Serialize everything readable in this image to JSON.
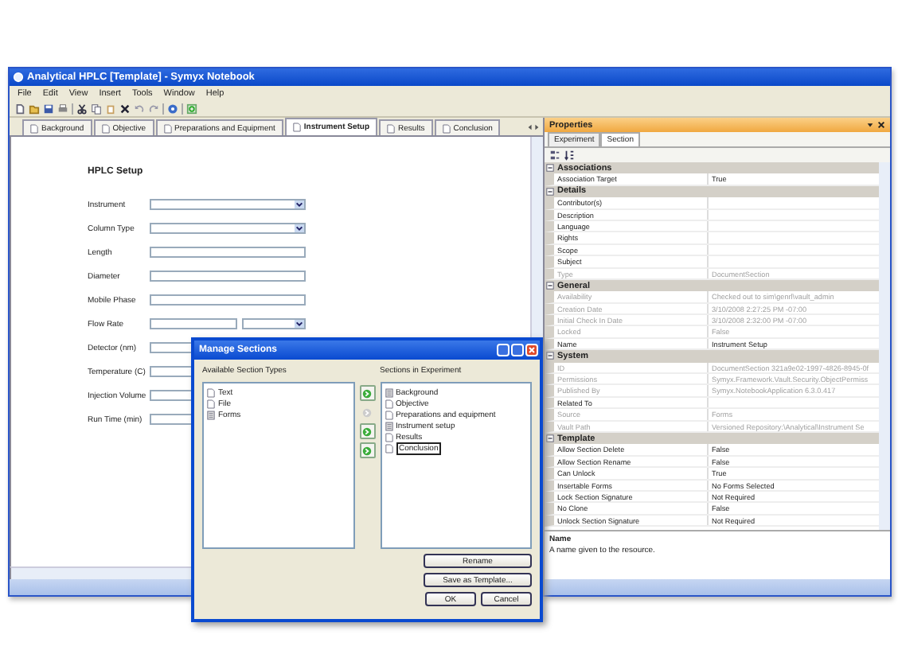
{
  "window": {
    "title": "Analytical HPLC [Template] - Symyx Notebook"
  },
  "menu": [
    "File",
    "Edit",
    "View",
    "Insert",
    "Tools",
    "Window",
    "Help"
  ],
  "tabs": [
    {
      "label": "Background",
      "selected": false
    },
    {
      "label": "Objective",
      "selected": false
    },
    {
      "label": "Preparations and Equipment",
      "selected": false
    },
    {
      "label": "Instrument Setup",
      "selected": true
    },
    {
      "label": "Results",
      "selected": false
    },
    {
      "label": "Conclusion",
      "selected": false
    }
  ],
  "form": {
    "title": "HPLC Setup",
    "fields": [
      {
        "label": "Instrument",
        "kind": "dropdown"
      },
      {
        "label": "Column Type",
        "kind": "dropdown"
      },
      {
        "label": "Length",
        "kind": "text"
      },
      {
        "label": "Diameter",
        "kind": "text"
      },
      {
        "label": "Mobile Phase",
        "kind": "text"
      },
      {
        "label": "Flow Rate",
        "kind": "text_dropdown"
      },
      {
        "label": "Detector (nm)",
        "kind": "text"
      },
      {
        "label": "Temperature (C)",
        "kind": "text"
      },
      {
        "label": "Injection Volume",
        "kind": "text"
      },
      {
        "label": "Run Time (min)",
        "kind": "text"
      }
    ]
  },
  "properties": {
    "title": "Properties",
    "tabs": [
      {
        "label": "Experiment",
        "selected": false
      },
      {
        "label": "Section",
        "selected": true
      }
    ],
    "sections": [
      {
        "title": "Associations",
        "expanded": true,
        "rows": [
          {
            "name": "Association Target",
            "value": "True",
            "disabled": false
          }
        ]
      },
      {
        "title": "Details",
        "expanded": true,
        "rows": [
          {
            "name": "Contributor(s)",
            "value": "",
            "disabled": false
          },
          {
            "name": "Description",
            "value": "",
            "disabled": false
          },
          {
            "name": "Language",
            "value": "",
            "disabled": false
          },
          {
            "name": "Rights",
            "value": "",
            "disabled": false
          },
          {
            "name": "Scope",
            "value": "",
            "disabled": false
          },
          {
            "name": "Subject",
            "value": "",
            "disabled": false
          },
          {
            "name": "Type",
            "value": "DocumentSection",
            "disabled": true
          }
        ]
      },
      {
        "title": "General",
        "expanded": true,
        "rows": [
          {
            "name": "Availability",
            "value": "Checked out to sim\\genrl\\vault_admin",
            "disabled": true
          },
          {
            "name": "Creation Date",
            "value": "3/10/2008 2:27:25 PM -07:00",
            "disabled": true
          },
          {
            "name": "Initial Check In Date",
            "value": "3/10/2008 2:32:00 PM -07:00",
            "disabled": true
          },
          {
            "name": "Locked",
            "value": "False",
            "disabled": true
          },
          {
            "name": "Name",
            "value": "Instrument Setup",
            "disabled": false
          }
        ]
      },
      {
        "title": "System",
        "expanded": true,
        "rows": [
          {
            "name": "ID",
            "value": "DocumentSection 321a9e02-1997-4826-8945-0f",
            "disabled": true
          },
          {
            "name": "Permissions",
            "value": "Symyx.Framework.Vault.Security.ObjectPermiss",
            "disabled": true
          },
          {
            "name": "Published By",
            "value": "Symyx.NotebookApplication 6.3.0.417",
            "disabled": true
          },
          {
            "name": "Related To",
            "value": "",
            "disabled": false
          },
          {
            "name": "Source",
            "value": "Forms",
            "disabled": true
          },
          {
            "name": "Vault Path",
            "value": "Versioned Repository:\\Analytical\\Instrument Se",
            "disabled": true
          }
        ]
      },
      {
        "title": "Template",
        "expanded": true,
        "rows": [
          {
            "name": "Allow Section Delete",
            "value": "False",
            "disabled": false
          },
          {
            "name": "Allow Section Rename",
            "value": "False",
            "disabled": false
          },
          {
            "name": "Can Unlock",
            "value": "True",
            "disabled": false
          },
          {
            "name": "Insertable Forms",
            "value": "No Forms Selected",
            "disabled": false
          },
          {
            "name": "Lock Section Signature",
            "value": "Not Required",
            "disabled": false
          },
          {
            "name": "No Clone",
            "value": "False",
            "disabled": false
          },
          {
            "name": "Unlock Section Signature",
            "value": "Not Required",
            "disabled": false
          }
        ]
      }
    ],
    "help_title": "Name",
    "help_text": "A name given to the resource."
  },
  "dialog": {
    "title": "Manage Sections",
    "available_label": "Available Section Types",
    "available": [
      {
        "label": "Text",
        "kind": "document"
      },
      {
        "label": "File",
        "kind": "document"
      },
      {
        "label": "Forms",
        "kind": "form"
      }
    ],
    "move_buttons": [
      {
        "disabled": false
      },
      {
        "disabled": true
      },
      {
        "disabled": false
      },
      {
        "disabled": false
      }
    ],
    "sections_label": "Sections in Experiment",
    "sections": [
      {
        "label": "Background",
        "kind": "form",
        "editing": false
      },
      {
        "label": "Objective",
        "kind": "document",
        "editing": false
      },
      {
        "label": "Preparations and equipment",
        "kind": "document",
        "editing": false
      },
      {
        "label": "Instrument setup",
        "kind": "form",
        "editing": false
      },
      {
        "label": "Results",
        "kind": "document",
        "editing": false
      },
      {
        "label": "Conclusion",
        "kind": "document",
        "editing": true
      }
    ],
    "buttons": [
      "Rename",
      "Save as Template...",
      "OK",
      "Cancel"
    ]
  }
}
